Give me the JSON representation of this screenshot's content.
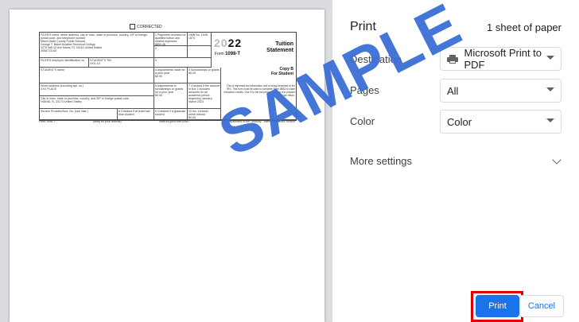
{
  "preview": {
    "form": {
      "corrected_label": "CORRECTED",
      "year": "2022",
      "year_light": "20",
      "year_bold": "22",
      "form_label_prefix": "Form",
      "form_number": "1098-T",
      "title_line1": "Tuition",
      "title_line2": "Statement",
      "copy_b_line1": "Copy B",
      "copy_b_line2": "For Student",
      "filer_name": "FILER'S name, street address, city or town, state or province, country, ZIP or foreign postal code, and telephone number",
      "school_line1": "Miami Dade County Public Schools",
      "school_line2": "George T. Baker Aviation Technical College",
      "school_line3": "3275 NW 42 Ave Miami, FL 33142 United States",
      "school_line4": "3058713145",
      "payments_label": "1 Payments received for qualified tuition and related expenses",
      "payments_value": "$850.46",
      "box2_label": "2",
      "omb_label": "OMB No. 1545-1574",
      "filer_tin": "FILER'S employer identification no.",
      "student_tin": "STUDENT'S TIN",
      "student_tin_value": "XXX-XX",
      "box3_label": "3",
      "student_name": "STUDENT'S name",
      "box4_label": "4 Adjustments made for a prior year",
      "box4_value": "$0.00",
      "box5_label": "5 Scholarships or grants",
      "box5_value": "$0.00",
      "street_label": "Street address (including apt. no.)",
      "street_value": "XXX    PLACE",
      "box6_label": "6 Adjustments to scholarships or grants for a prior year",
      "box6_value": "$0.00",
      "box7_label": "7 Checked if the amount in box 1 includes amounts for an academic period beginning January-March 2023",
      "city_label": "City or town, state or province, country, and ZIP or foreign postal code",
      "city_value": "HIANIA, FL 33173 United States",
      "service_label": "Service Provider/Acct. No. (see instr.)",
      "box8_label": "8 Checked if at least half-time student",
      "box9_label": "9 Checked if a graduate student",
      "box10_label": "10 Ins. contract reimb./refund",
      "box10_value": "$0.00",
      "footer_form": "Form 1098-T",
      "footer_keep": "(keep for your records)",
      "footer_url": "www.irs.gov/Form1098T",
      "footer_dept": "Department of the Treasury - Internal Revenue Service",
      "side_note": "This is important tax information and is being furnished to the IRS. This form must be used to complete Form 8863 to claim education credits. Give it to the tax preparer or use it to prepare the tax return."
    },
    "watermark": "SAMPLE"
  },
  "panel": {
    "title": "Print",
    "sheets": "1 sheet of paper",
    "destination_label": "Destination",
    "destination_value": "Microsoft Print to PDF",
    "pages_label": "Pages",
    "pages_value": "All",
    "color_label": "Color",
    "color_value": "Color",
    "more_settings": "More settings",
    "print_button": "Print",
    "cancel_button": "Cancel"
  },
  "colors": {
    "accent": "#1a73e8",
    "highlight": "#e00000",
    "watermark": "#3a6fd6"
  },
  "icons": [
    "printer-icon",
    "caret-down-icon",
    "chevron-down-icon"
  ]
}
